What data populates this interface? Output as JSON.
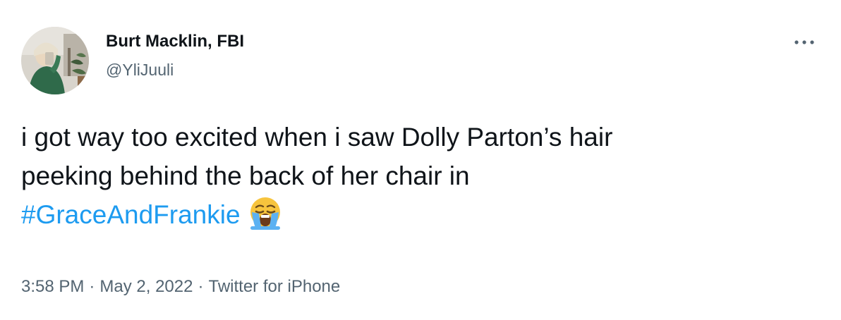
{
  "author": {
    "display_name": "Burt Macklin, FBI",
    "handle": "@YliJuuli",
    "avatar_icon": "profile-photo"
  },
  "tweet": {
    "line1": "i got way too excited when i saw Dolly Parton’s hair",
    "line2": "peeking behind the back of her chair in",
    "hashtag": "#GraceAndFrankie",
    "emoji_icon": "loudly-crying-face-emoji"
  },
  "meta": {
    "time": "3:58 PM",
    "separator": "·",
    "date": "May 2, 2022",
    "source": "Twitter for iPhone"
  },
  "colors": {
    "text": "#0f1419",
    "secondary": "#536471",
    "link": "#1d9bf0",
    "background": "#ffffff"
  },
  "icons": {
    "more": "more-options-icon"
  }
}
